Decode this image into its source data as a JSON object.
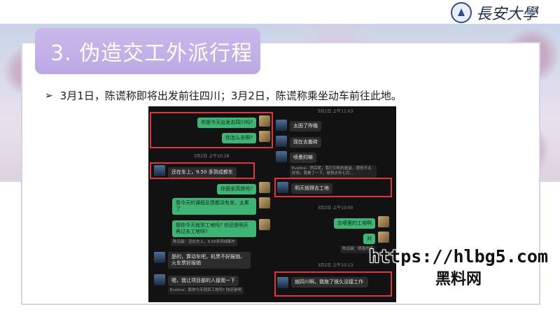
{
  "header": {
    "university_name": "長安大學"
  },
  "slide": {
    "title": "3. 伪造交工外派行程",
    "bullet": "3月1日，陈谎称即将出发前往四川；3月2日，陈谎称乘坐动车前往此地。"
  },
  "chat_left": {
    "msg1": "你是今天出发去四川吗?",
    "msg2": "你怎么去啊?",
    "ts1": "3月2日 上午10:28",
    "msg3": "还在车上，9.50 多到成都东",
    "msg4": "你是坐高铁吗?",
    "msg5": "我今天的课程反馈都没有发，太累了",
    "msg6": "那你今天就到工地吗? 你还是明天再过去工地呀?",
    "quote1": "陈远晨：还在车上，9.50多到成都东",
    "msg7": "是的，算动车吧，机票不好报销，火车票好报销",
    "msg8": "嗯，我让项目部的人接我一下",
    "quote2": "Evelina：那你今天就到工地吗? 你还是明"
  },
  "chat_right": {
    "ts1": "3月1日 上午11:03",
    "msg1": "太困了昨晚",
    "msg2": "现在去搬砖",
    "msg3": "喷墨的嘛",
    "quote1": "Evelina：然后呢，我打印机的墨盒，感觉不太好用，我看了一下，是我去年七月...",
    "msg4": "明天就得去工地",
    "ts2": "3月2日 上午10:00",
    "msg5": "去哪里的工地啊",
    "msg6": "对",
    "quote2": "陈远晨：喷墨的嘛",
    "ts3": "3月2日 上午10:13",
    "msg7": "就四川啊，我拖了很久没接工作"
  },
  "watermark": {
    "url": "https://hlbg5.com",
    "name": "黑料网"
  }
}
